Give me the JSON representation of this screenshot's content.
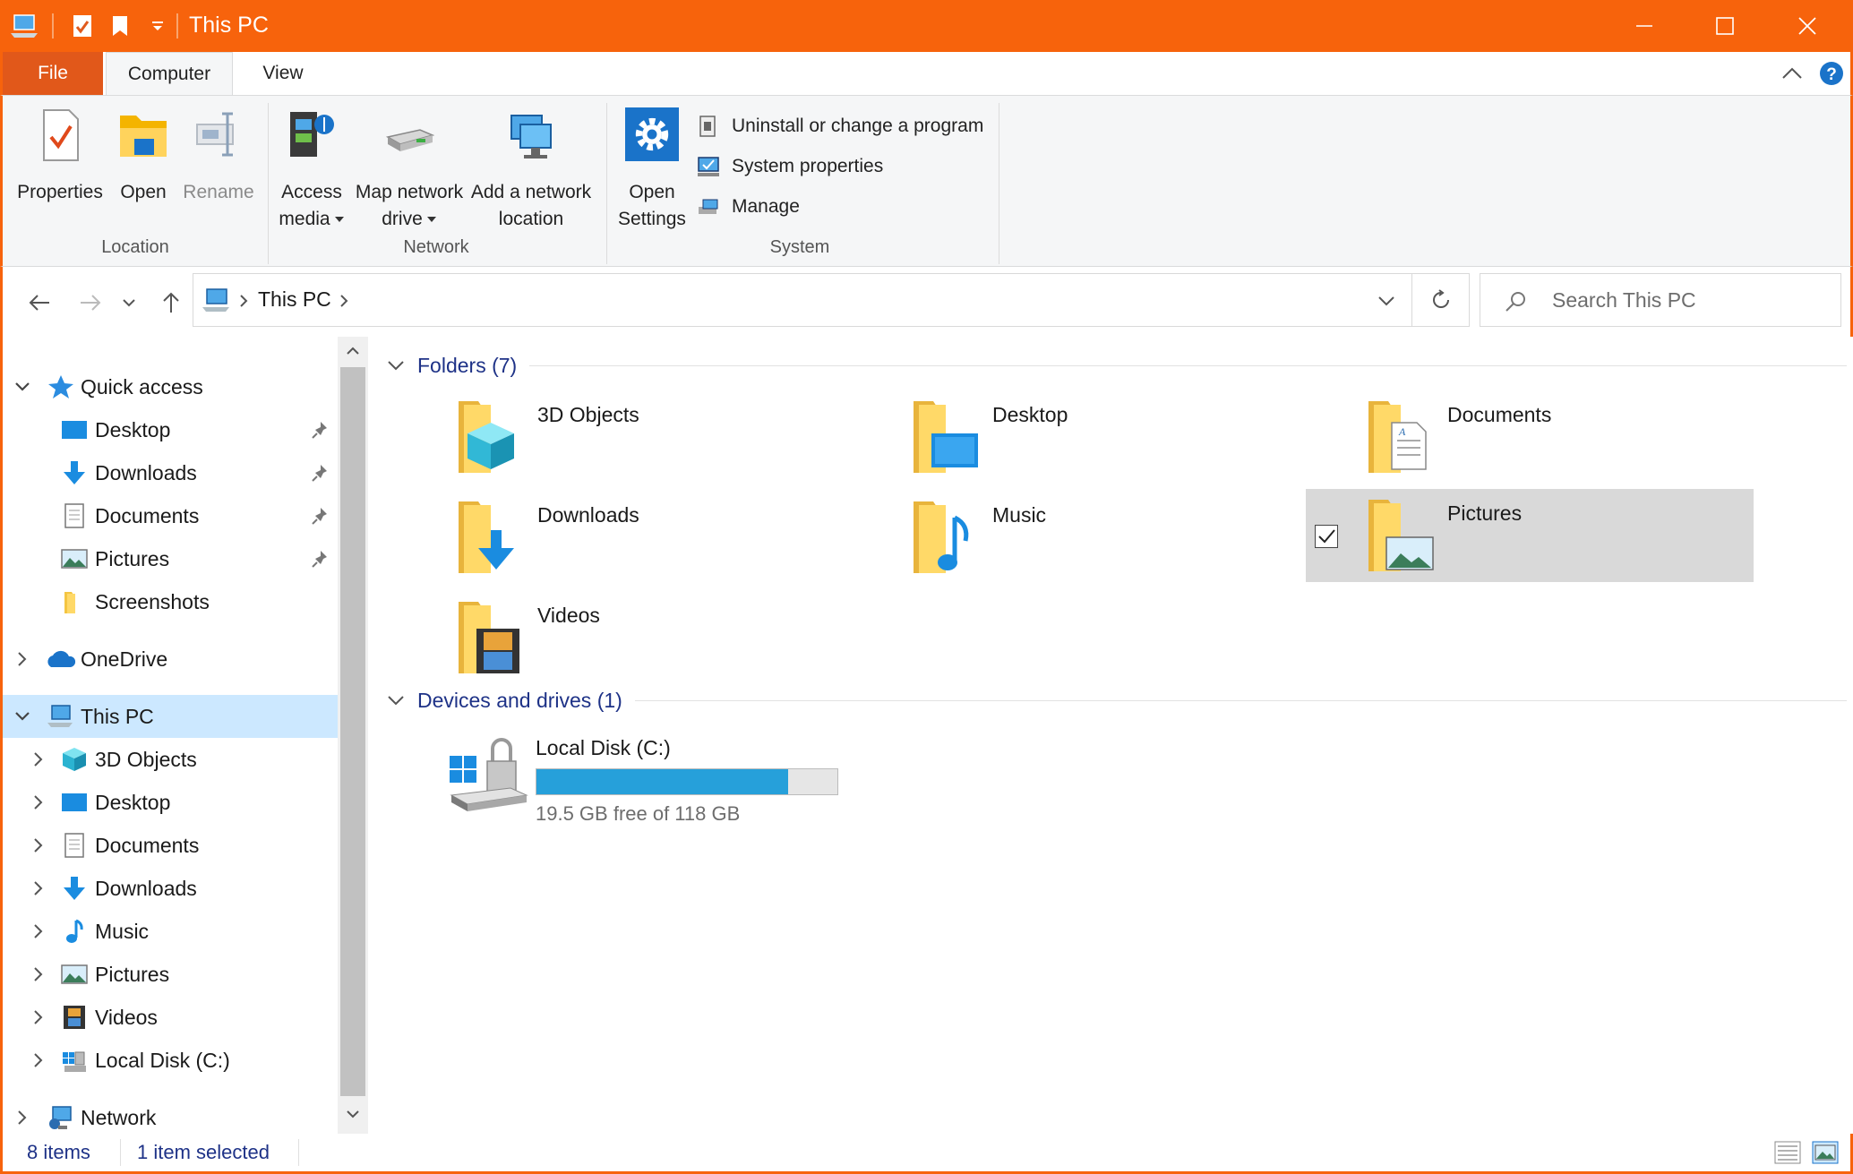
{
  "window": {
    "title": "This PC",
    "accent": "#F7630C"
  },
  "ribbon_tabs": {
    "file": "File",
    "computer": "Computer",
    "view": "View"
  },
  "ribbon": {
    "properties": "Properties",
    "open": "Open",
    "rename": "Rename",
    "access_media_1": "Access",
    "access_media_2": "media",
    "map_drive_1": "Map network",
    "map_drive_2": "drive",
    "add_location_1": "Add a network",
    "add_location_2": "location",
    "open_settings_1": "Open",
    "open_settings_2": "Settings",
    "uninstall": "Uninstall or change a program",
    "system_properties": "System properties",
    "manage": "Manage",
    "groups": {
      "location": "Location",
      "network": "Network",
      "system": "System"
    }
  },
  "address": {
    "path": "This PC",
    "search_placeholder": "Search This PC"
  },
  "nav": {
    "quick_access": "Quick access",
    "quick_items": [
      "Desktop",
      "Downloads",
      "Documents",
      "Pictures",
      "Screenshots"
    ],
    "onedrive": "OneDrive",
    "this_pc": "This PC",
    "pc_items": [
      "3D Objects",
      "Desktop",
      "Documents",
      "Downloads",
      "Music",
      "Pictures",
      "Videos",
      "Local Disk (C:)"
    ],
    "network": "Network"
  },
  "content": {
    "folders_header": "Folders (7)",
    "folders": [
      "3D Objects",
      "Desktop",
      "Documents",
      "Downloads",
      "Music",
      "Pictures",
      "Videos"
    ],
    "selected_folder": "Pictures",
    "devices_header": "Devices and drives (1)",
    "drive": {
      "name": "Local Disk (C:)",
      "free_text": "19.5 GB free of 118 GB",
      "used_fraction": 0.835
    }
  },
  "status": {
    "items": "8 items",
    "selected": "1 item selected"
  }
}
